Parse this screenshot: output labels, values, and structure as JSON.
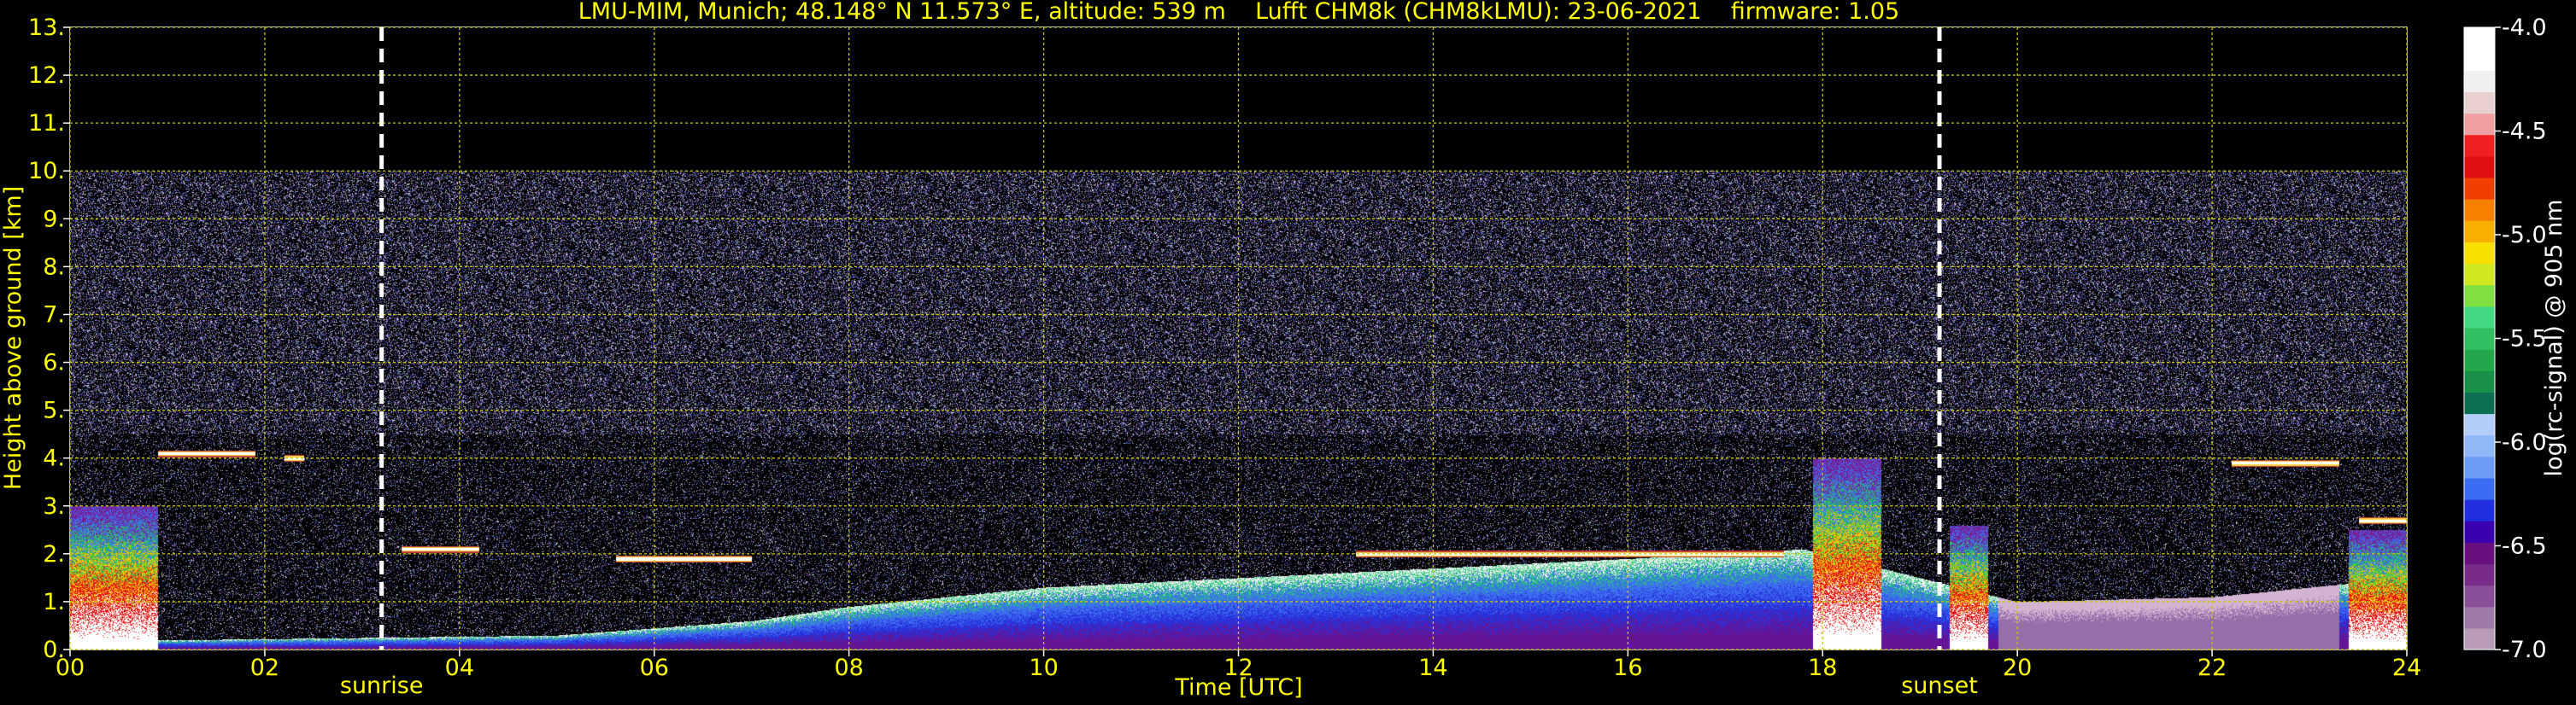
{
  "chart_data": {
    "type": "heatmap",
    "title": "LMU-MIM, Munich; 48.148° N 11.573° E, altitude: 539 m    Lufft CHM8k (CHM8kLMU): 23-06-2021    firmware: 1.05",
    "xlabel": "Time [UTC]",
    "ylabel": "Height above ground [km]",
    "colorbar_label": "log(rc-signal) @ 905 nm",
    "xlim": [
      0,
      24
    ],
    "ylim": [
      0,
      13
    ],
    "x_ticks": [
      "00",
      "02",
      "04",
      "06",
      "08",
      "10",
      "12",
      "14",
      "16",
      "18",
      "20",
      "22",
      "24"
    ],
    "y_ticks": [
      "0.",
      "1.",
      "2.",
      "3.",
      "4.",
      "5.",
      "6.",
      "7.",
      "8.",
      "9.",
      "10.",
      "11.",
      "12.",
      "13."
    ],
    "colorbar_range": [
      -7.0,
      -4.0
    ],
    "colorbar_ticks": [
      "-4.0",
      "-4.5",
      "-5.0",
      "-5.5",
      "-6.0",
      "-6.5",
      "-7.0"
    ],
    "grid": true,
    "data_top_km": 10,
    "annotations": [
      {
        "label": "sunrise",
        "time_hours": 3.2
      },
      {
        "label": "sunset",
        "time_hours": 19.2
      }
    ],
    "features": {
      "aerosol_layer_top_km": [
        {
          "t": 1.0,
          "h": 0.2
        },
        {
          "t": 3.0,
          "h": 0.25
        },
        {
          "t": 5.0,
          "h": 0.3
        },
        {
          "t": 7.0,
          "h": 0.6
        },
        {
          "t": 8.0,
          "h": 0.9
        },
        {
          "t": 10.0,
          "h": 1.3
        },
        {
          "t": 12.0,
          "h": 1.5
        },
        {
          "t": 14.0,
          "h": 1.7
        },
        {
          "t": 16.0,
          "h": 1.9
        },
        {
          "t": 17.8,
          "h": 2.1
        },
        {
          "t": 20.0,
          "h": 1.0
        },
        {
          "t": 22.0,
          "h": 1.1
        },
        {
          "t": 23.5,
          "h": 1.4
        }
      ],
      "cloud_layers": [
        {
          "t_start": 0.9,
          "t_end": 1.9,
          "h": 4.1
        },
        {
          "t_start": 2.2,
          "t_end": 2.4,
          "h": 4.0
        },
        {
          "t_start": 3.4,
          "t_end": 4.2,
          "h": 2.1
        },
        {
          "t_start": 5.6,
          "t_end": 7.0,
          "h": 1.9
        },
        {
          "t_start": 13.2,
          "t_end": 17.6,
          "h": 2.0
        },
        {
          "t_start": 22.2,
          "t_end": 23.3,
          "h": 3.9
        },
        {
          "t_start": 23.5,
          "t_end": 24.0,
          "h": 2.7
        }
      ],
      "rain_or_fog_periods": [
        {
          "t_start": 0.0,
          "t_end": 0.9,
          "h": 3.0
        },
        {
          "t_start": 17.9,
          "t_end": 18.6,
          "h": 4.0
        },
        {
          "t_start": 19.3,
          "t_end": 19.7,
          "h": 2.6
        },
        {
          "t_start": 23.4,
          "t_end": 24.0,
          "h": 2.5
        }
      ]
    }
  },
  "colors": {
    "text": "#ffff00",
    "grid": "#c8c800",
    "background": "#000000",
    "annotation_line": "#ffffff",
    "colorbar": [
      "#b89bb4",
      "#9e7aa8",
      "#8b4e98",
      "#7a2a8a",
      "#6a0f80",
      "#3a00b0",
      "#2030e0",
      "#3a6cf4",
      "#6a9cf8",
      "#8fb8f8",
      "#b4ccf8",
      "#0c6e52",
      "#18904a",
      "#22a84a",
      "#30c060",
      "#40d880",
      "#80e040",
      "#d0e820",
      "#f8e000",
      "#f8b000",
      "#f88000",
      "#f04000",
      "#e01010",
      "#f02020",
      "#f0a0a0",
      "#e8d0d0",
      "#f0f0f0",
      "#ffffff",
      "#ffffff"
    ]
  }
}
